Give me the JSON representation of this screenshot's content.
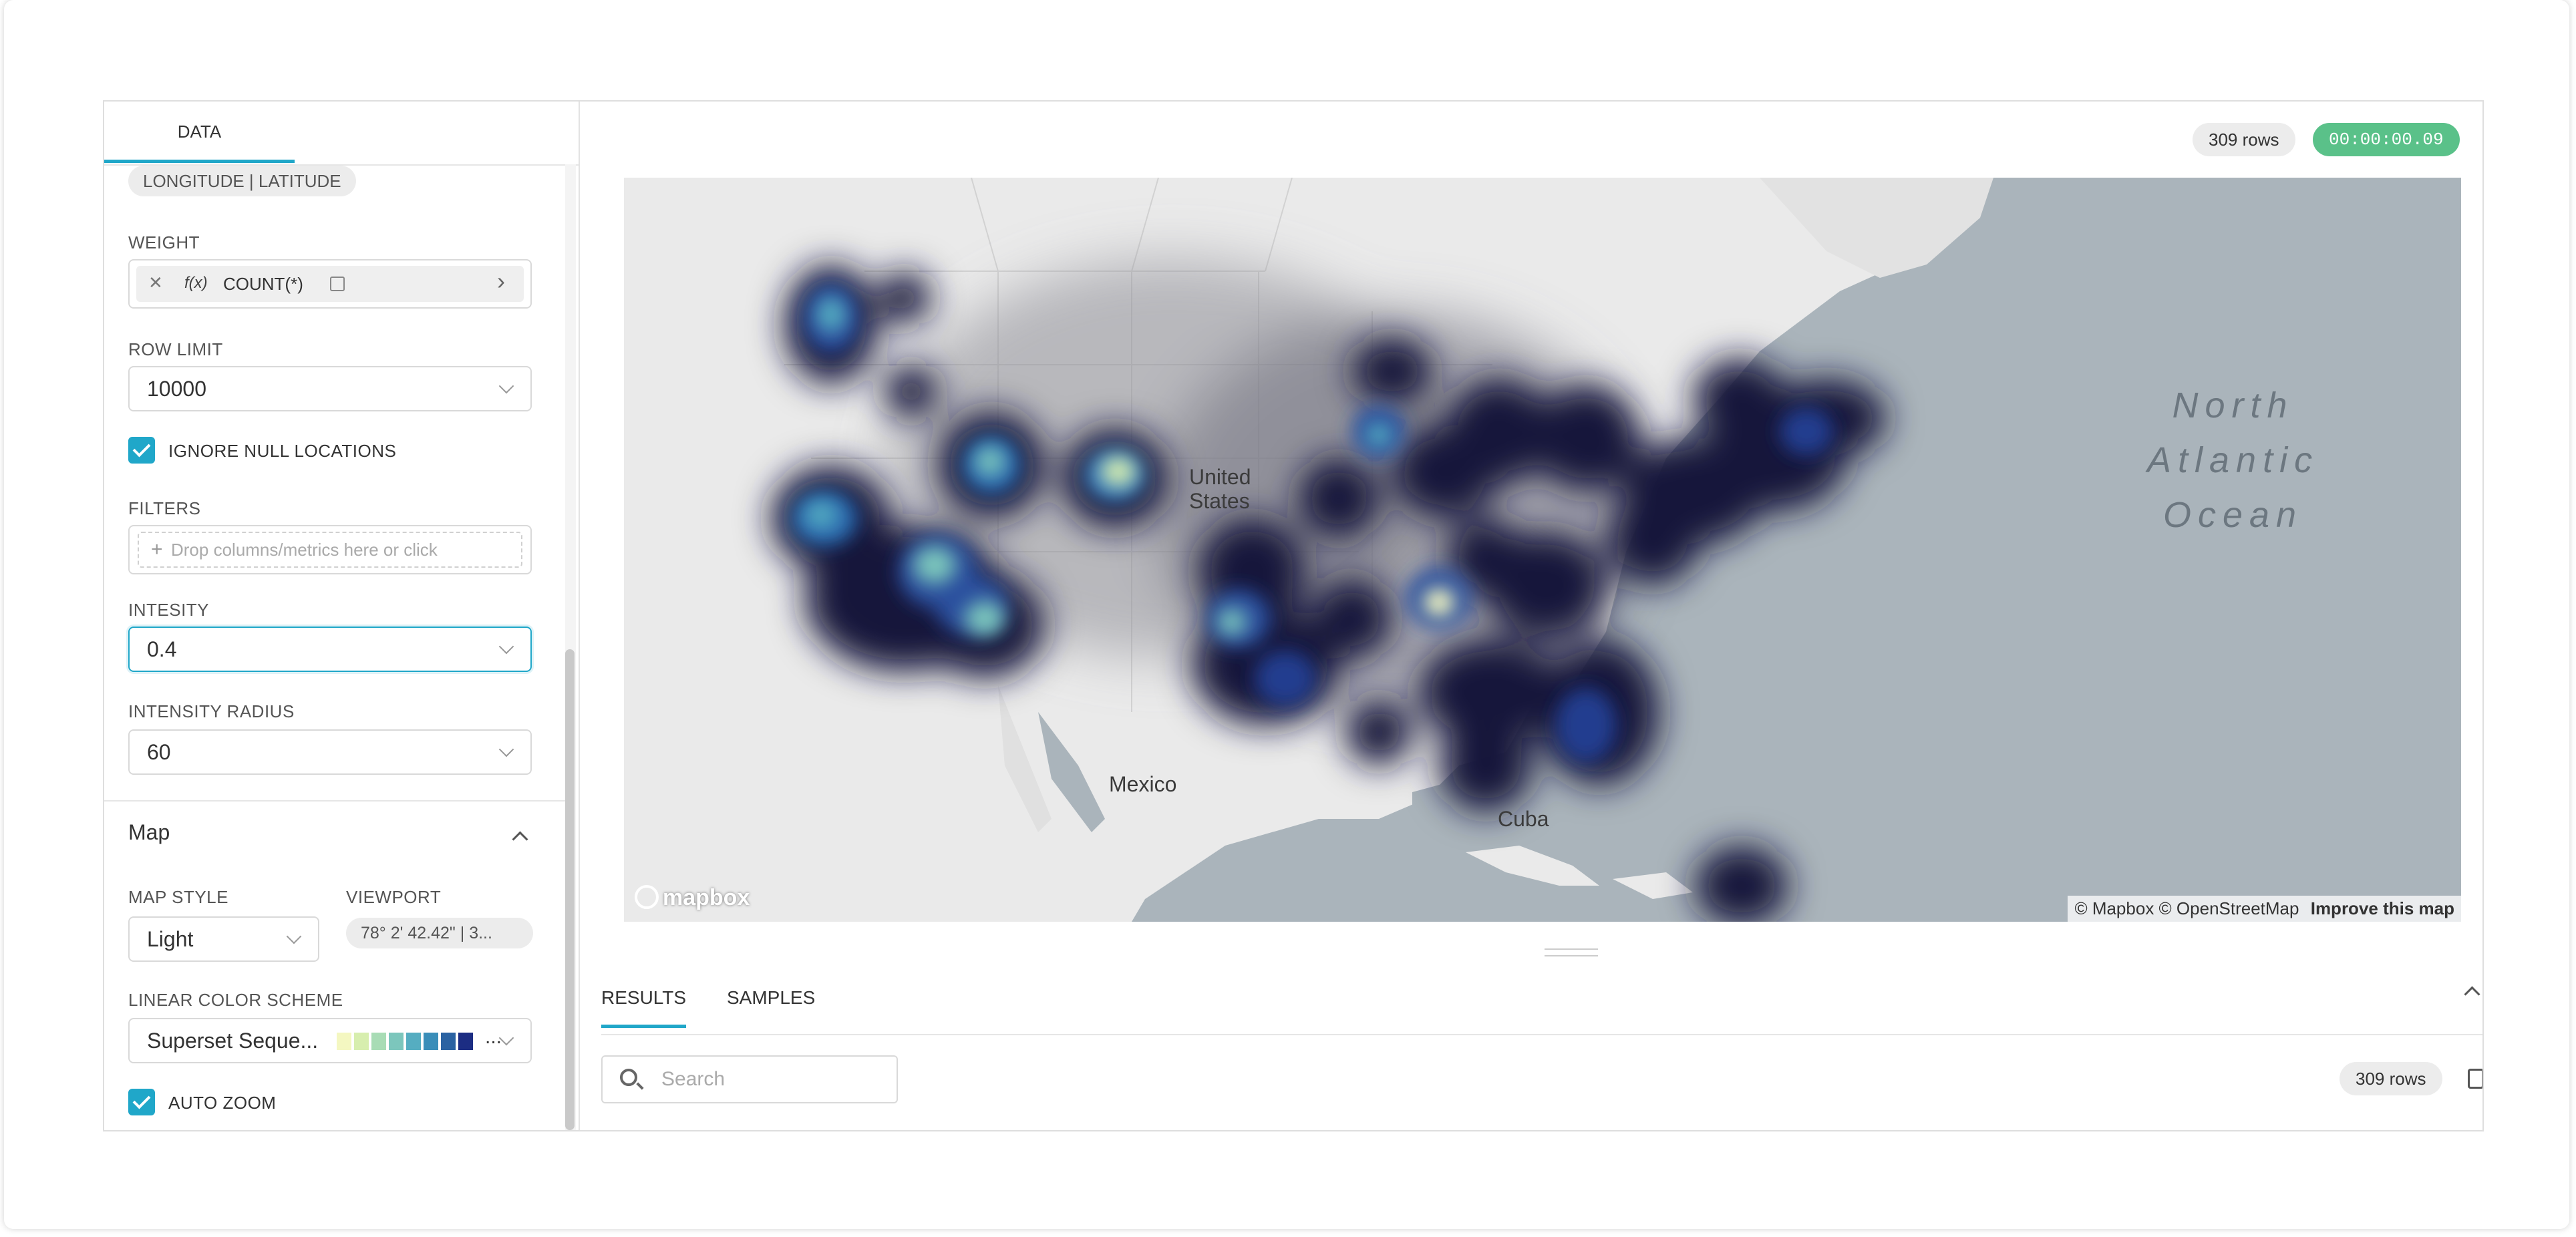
{
  "tabs": {
    "data": "DATA"
  },
  "spatial": {
    "pill": "LONGITUDE | LATITUDE"
  },
  "weight": {
    "label": "WEIGHT",
    "func": "f(x)",
    "metric": "COUNT(*)"
  },
  "row_limit": {
    "label": "ROW LIMIT",
    "value": "10000"
  },
  "ignore_null": {
    "label": "IGNORE NULL LOCATIONS",
    "checked": true
  },
  "filters": {
    "label": "FILTERS",
    "placeholder": "Drop columns/metrics here or click"
  },
  "intensity": {
    "label": "INTESITY",
    "value": "0.4"
  },
  "intensity_radius": {
    "label": "INTENSITY RADIUS",
    "value": "60"
  },
  "map_section": {
    "title": "Map"
  },
  "map_style": {
    "label": "MAP STYLE",
    "value": "Light"
  },
  "viewport": {
    "label": "VIEWPORT",
    "value": "78° 2' 42.42\" | 3..."
  },
  "color_scheme": {
    "label": "LINEAR COLOR SCHEME",
    "value": "Superset Seque...",
    "swatches": [
      "#f4f7c1",
      "#d7eeae",
      "#a8dcb5",
      "#7cc6bc",
      "#55adc1",
      "#3a8eb9",
      "#2a62a2",
      "#1c2d83"
    ]
  },
  "auto_zoom": {
    "label": "AUTO ZOOM",
    "checked": true
  },
  "header": {
    "rows": "309 rows",
    "time": "00:00:00.09"
  },
  "map": {
    "labels": {
      "united": "United",
      "states": "States",
      "mexico": "Mexico",
      "cuba": "Cuba"
    },
    "ocean": [
      "North",
      "Atlantic",
      "Ocean"
    ],
    "logo": "mapbox",
    "attribution": "© Mapbox © OpenStreetMap",
    "improve": "Improve this map"
  },
  "results": {
    "tabs": [
      "RESULTS",
      "SAMPLES"
    ],
    "search_placeholder": "Search",
    "rows": "309 rows"
  },
  "colors": {
    "accent": "#20a7c9",
    "success": "#5ac189"
  }
}
